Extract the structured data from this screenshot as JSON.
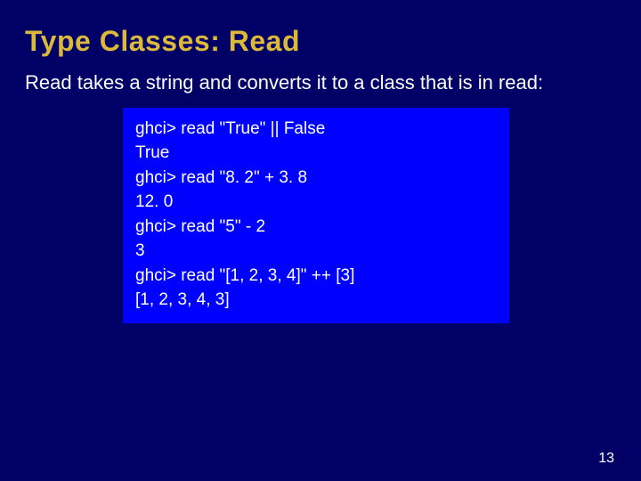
{
  "slide": {
    "title": "Type Classes: Read",
    "description": "Read takes a string and converts it to a class that is in read:",
    "code_lines": [
      "ghci> read \"True\" || False",
      "True",
      "ghci> read \"8. 2\" + 3. 8",
      "12. 0",
      "ghci> read \"5\" - 2",
      "3",
      "ghci> read \"[1, 2, 3, 4]\" ++ [3]",
      "[1, 2, 3, 4, 3]"
    ],
    "page_number": "13"
  }
}
